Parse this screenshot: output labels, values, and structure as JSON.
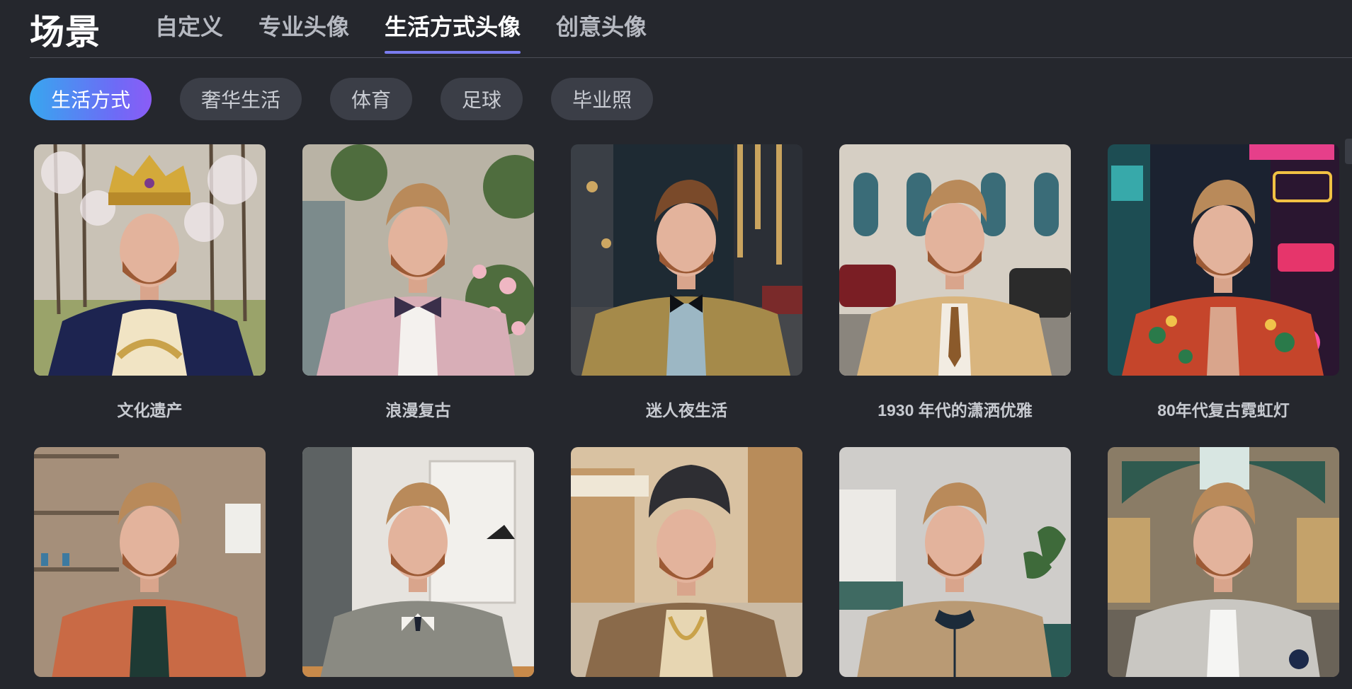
{
  "header": {
    "title": "场景",
    "tabs": [
      {
        "label": "自定义",
        "active": false
      },
      {
        "label": "专业头像",
        "active": false
      },
      {
        "label": "生活方式头像",
        "active": true
      },
      {
        "label": "创意头像",
        "active": false
      }
    ]
  },
  "chips": [
    {
      "label": "生活方式",
      "active": true
    },
    {
      "label": "奢华生活",
      "active": false
    },
    {
      "label": "体育",
      "active": false
    },
    {
      "label": "足球",
      "active": false
    },
    {
      "label": "毕业照",
      "active": false
    }
  ],
  "cards_row1": [
    {
      "label": "文化遗产"
    },
    {
      "label": "浪漫复古"
    },
    {
      "label": "迷人夜生活"
    },
    {
      "label": "1930 年代的潇洒优雅"
    },
    {
      "label": "80年代复古霓虹灯"
    }
  ],
  "cards_row2": [
    {
      "label": ""
    },
    {
      "label": ""
    },
    {
      "label": ""
    },
    {
      "label": ""
    },
    {
      "label": ""
    }
  ],
  "colors": {
    "background": "#25272d",
    "accent_underline": "#7a7cf0",
    "chip_gradient_start": "#38a6ef",
    "chip_gradient_end": "#8b5cf6"
  }
}
